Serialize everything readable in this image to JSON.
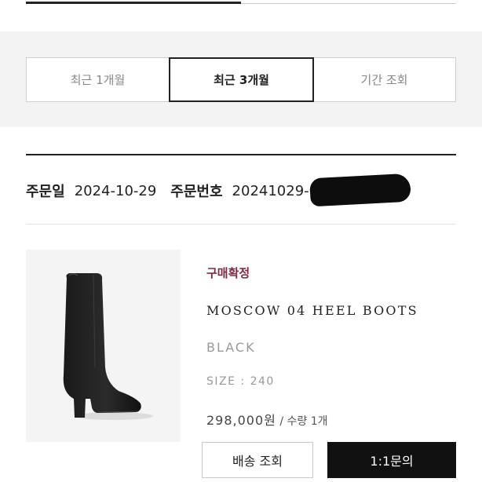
{
  "period": {
    "options": [
      "최근 1개월",
      "최근 3개월",
      "기간 조회"
    ],
    "selected": "최근 3개월"
  },
  "order": {
    "date_label": "주문일",
    "date_value": "2024-10-29",
    "number_label": "주문번호",
    "number_value": "20241029-00"
  },
  "item": {
    "status": "구매확정",
    "name": "MOSCOW 04 HEEL BOOTS",
    "color": "BLACK",
    "size": "SIZE : 240",
    "price": "298,000원",
    "quantity": " / 수량 1개"
  },
  "actions": {
    "shipping_label": "배송 조회",
    "inquiry_label": "1:1문의"
  },
  "colors": {
    "status": "#7a2e44",
    "dark_button": "#111111",
    "panel_bg": "#f3f3f3"
  }
}
